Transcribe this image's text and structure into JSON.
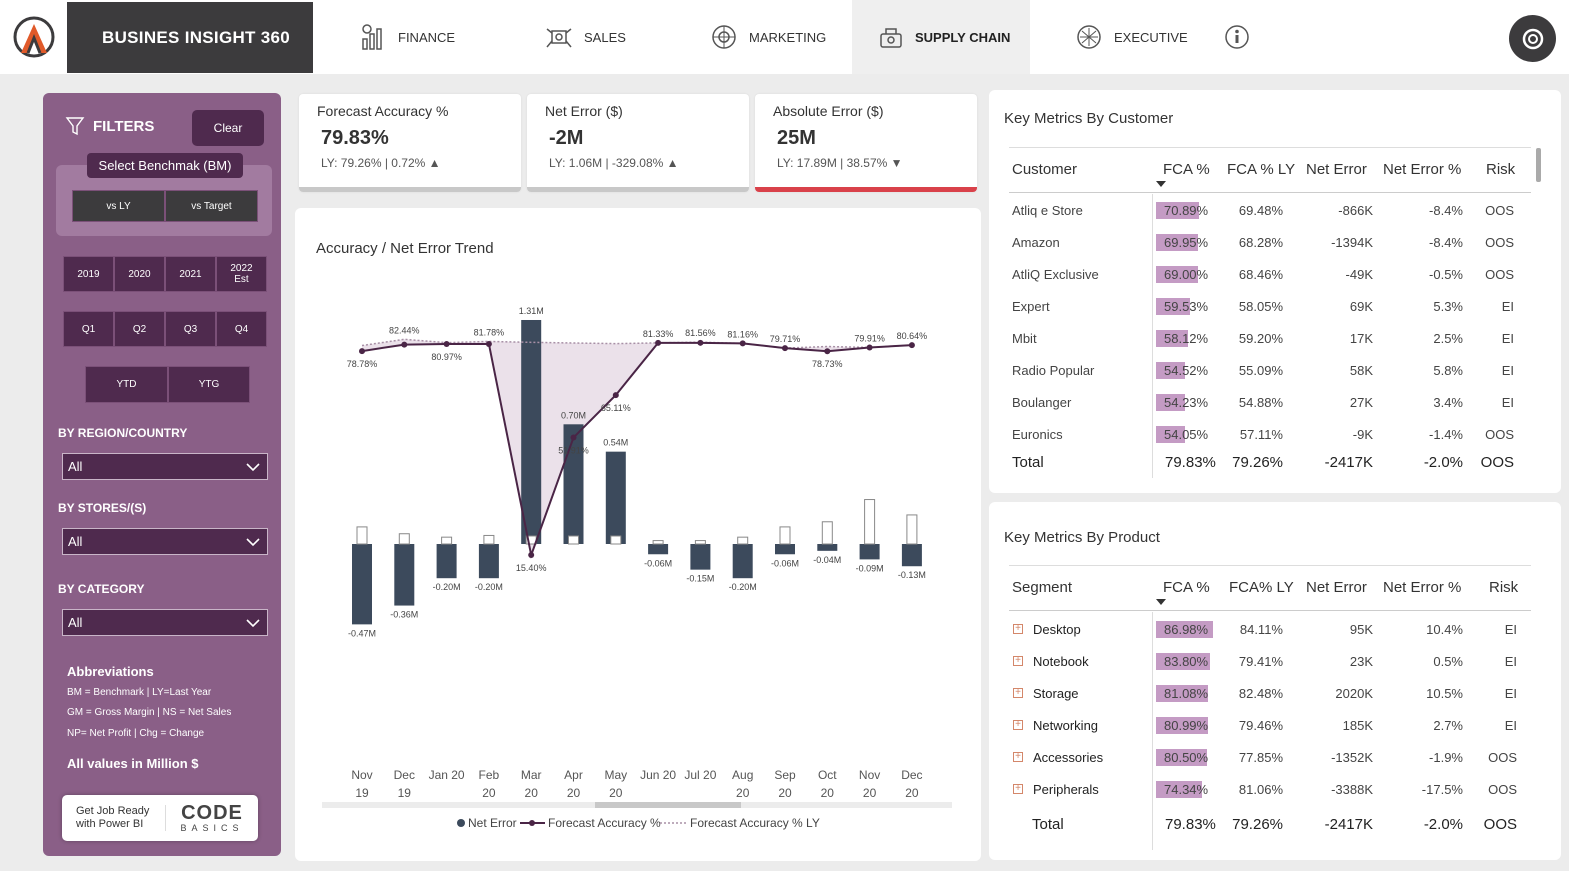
{
  "app": {
    "title": "BUSINES INSIGHT 360"
  },
  "nav": [
    {
      "label": "FINANCE",
      "icon": "finance-chart-icon"
    },
    {
      "label": "SALES",
      "icon": "sales-icon"
    },
    {
      "label": "MARKETING",
      "icon": "marketing-icon"
    },
    {
      "label": "SUPPLY CHAIN",
      "icon": "supply-chain-icon",
      "active": true
    },
    {
      "label": "EXECUTIVE",
      "icon": "executive-icon"
    }
  ],
  "filters": {
    "title": "FILTERS",
    "clear": "Clear",
    "benchmark_title": "Select Benchmak (BM)",
    "benchmark_options": [
      "vs LY",
      "vs Target"
    ],
    "years": [
      "2019",
      "2020",
      "2021",
      "2022 Est"
    ],
    "quarters": [
      "Q1",
      "Q2",
      "Q3",
      "Q4"
    ],
    "ytd": [
      "YTD",
      "YTG"
    ],
    "region_label": "BY REGION/COUNTRY",
    "region_value": "All",
    "stores_label": "BY STORES/(S)",
    "stores_value": "All",
    "category_label": "BY CATEGORY",
    "category_value": "All",
    "abbr_title": "Abbreviations",
    "abbr_lines": [
      "BM = Benchmark | LY=Last Year",
      "GM = Gross Margin | NS = Net Sales",
      "NP= Net Profit | Chg = Change"
    ],
    "values_note": "All values in Million $",
    "promo_text": "Get Job Ready with Power BI",
    "promo_logo_big": "CODE",
    "promo_logo_small": "BASICS"
  },
  "kpis": [
    {
      "title": "Forecast Accuracy %",
      "value": "79.83%",
      "sub": "LY: 79.26% | 0.72%",
      "trend": "up"
    },
    {
      "title": "Net Error ($)",
      "value": "-2M",
      "sub": "LY: 1.06M | -329.08%",
      "trend": "up"
    },
    {
      "title": "Absolute Error ($)",
      "value": "25M",
      "sub": "LY: 17.89M | 38.57%",
      "trend": "down"
    }
  ],
  "chart_data": {
    "type": "bar",
    "title": "Accuracy / Net Error Trend",
    "categories": [
      "Nov 19",
      "Dec 19",
      "Jan 20",
      "Feb 20",
      "Mar 20",
      "Apr 20",
      "May 20",
      "Jun 20",
      "Jul 20",
      "Aug 20",
      "Sep 20",
      "Oct 20",
      "Nov 20",
      "Dec 20"
    ],
    "tick_labels": [
      [
        "Nov",
        "19"
      ],
      [
        "Dec",
        "19"
      ],
      [
        "Jan 20",
        ""
      ],
      [
        "Feb",
        "20"
      ],
      [
        "Mar",
        "20"
      ],
      [
        "Apr",
        "20"
      ],
      [
        "May",
        "20"
      ],
      [
        "Jun 20",
        ""
      ],
      [
        "Jul 20",
        ""
      ],
      [
        "Aug",
        "20"
      ],
      [
        "Sep",
        "20"
      ],
      [
        "Oct",
        "20"
      ],
      [
        "Nov",
        "20"
      ],
      [
        "Dec",
        "20"
      ]
    ],
    "series": [
      {
        "name": "Net Error",
        "kind": "bar",
        "unit": "M",
        "values": [
          -0.47,
          -0.36,
          -0.2,
          -0.2,
          1.31,
          0.7,
          0.54,
          -0.06,
          -0.15,
          -0.2,
          -0.06,
          -0.04,
          -0.09,
          -0.13
        ],
        "labels": [
          "-0.47M",
          "-0.36M",
          "-0.20M",
          "-0.20M",
          "1.31M",
          "0.70M",
          "0.54M",
          "-0.06M",
          "-0.15M",
          "-0.20M",
          "-0.06M",
          "-0.04M",
          "-0.09M",
          "-0.13M"
        ]
      },
      {
        "name": "Forecast Accuracy %",
        "kind": "line",
        "unit": "%",
        "values": [
          78.78,
          80.8,
          80.97,
          81.0,
          15.4,
          51.91,
          65.11,
          81.33,
          81.35,
          81.16,
          79.71,
          78.73,
          79.91,
          80.64
        ],
        "labels": [
          "78.78%",
          "",
          "80.97%",
          "",
          "15.40%",
          "51.91%",
          "65.11%",
          "",
          "",
          "",
          "",
          "78.73%",
          "",
          ""
        ]
      },
      {
        "name": "Forecast Accuracy % LY",
        "kind": "dotted-line",
        "unit": "%",
        "values": [
          80.5,
          82.44,
          81.4,
          81.78,
          81.5,
          81.3,
          81.1,
          81.33,
          81.56,
          81.16,
          79.71,
          80.2,
          79.91,
          80.64
        ],
        "labels": [
          "",
          "82.44%",
          "",
          "81.78%",
          "",
          "",
          "",
          "81.33%",
          "81.56%",
          "81.16%",
          "79.71%",
          "",
          "79.91%",
          "80.64%"
        ]
      }
    ],
    "ly_net_error": [
      -0.1,
      -0.06,
      -0.04,
      -0.05,
      -0.04,
      -0.04,
      -0.02,
      -0.02,
      -0.02,
      -0.04,
      -0.1,
      -0.13,
      -0.26,
      -0.17
    ],
    "legend": [
      "Net Error",
      "Forecast Accuracy %",
      "Forecast Accuracy % LY"
    ],
    "legend_position": "bottom",
    "colors": {
      "bar": "#3c4a5c",
      "line": "#4a2546",
      "ly": "#a890a6",
      "fill": "#ebe1ea"
    }
  },
  "customer_table": {
    "title": "Key Metrics By Customer",
    "headers": [
      "Customer",
      "FCA %",
      "FCA % LY",
      "Net Error",
      "Net Error %",
      "Risk"
    ],
    "rows": [
      {
        "name": "Atliq e Store",
        "fca": "70.89%",
        "fca_num": 70.89,
        "fca_ly": "69.48%",
        "net_error": "-866K",
        "net_error_pct": "-8.4%",
        "risk": "OOS"
      },
      {
        "name": "Amazon",
        "fca": "69.95%",
        "fca_num": 69.95,
        "fca_ly": "68.28%",
        "net_error": "-1394K",
        "net_error_pct": "-8.4%",
        "risk": "OOS"
      },
      {
        "name": "AtliQ Exclusive",
        "fca": "69.00%",
        "fca_num": 69.0,
        "fca_ly": "68.46%",
        "net_error": "-49K",
        "net_error_pct": "-0.5%",
        "risk": "OOS"
      },
      {
        "name": "Expert",
        "fca": "59.53%",
        "fca_num": 59.53,
        "fca_ly": "58.05%",
        "net_error": "69K",
        "net_error_pct": "5.3%",
        "risk": "EI"
      },
      {
        "name": "Mbit",
        "fca": "58.12%",
        "fca_num": 58.12,
        "fca_ly": "59.20%",
        "net_error": "17K",
        "net_error_pct": "2.5%",
        "risk": "EI"
      },
      {
        "name": "Radio Popular",
        "fca": "54.52%",
        "fca_num": 54.52,
        "fca_ly": "55.09%",
        "net_error": "58K",
        "net_error_pct": "5.8%",
        "risk": "EI"
      },
      {
        "name": "Boulanger",
        "fca": "54.23%",
        "fca_num": 54.23,
        "fca_ly": "54.88%",
        "net_error": "27K",
        "net_error_pct": "3.4%",
        "risk": "EI"
      },
      {
        "name": "Euronics",
        "fca": "54.05%",
        "fca_num": 54.05,
        "fca_ly": "57.11%",
        "net_error": "-9K",
        "net_error_pct": "-1.4%",
        "risk": "OOS"
      }
    ],
    "total": {
      "name": "Total",
      "fca": "79.83%",
      "fca_ly": "79.26%",
      "net_error": "-2417K",
      "net_error_pct": "-2.0%",
      "risk": "OOS"
    }
  },
  "product_table": {
    "title": "Key Metrics By Product",
    "headers": [
      "Segment",
      "FCA %",
      "FCA% LY",
      "Net Error",
      "Net Error %",
      "Risk"
    ],
    "rows": [
      {
        "name": "Desktop",
        "fca": "86.98%",
        "fca_num": 86.98,
        "fca_ly": "84.11%",
        "net_error": "95K",
        "net_error_pct": "10.4%",
        "risk": "EI"
      },
      {
        "name": "Notebook",
        "fca": "83.80%",
        "fca_num": 83.8,
        "fca_ly": "79.41%",
        "net_error": "23K",
        "net_error_pct": "0.5%",
        "risk": "EI"
      },
      {
        "name": "Storage",
        "fca": "81.08%",
        "fca_num": 81.08,
        "fca_ly": "82.48%",
        "net_error": "2020K",
        "net_error_pct": "10.5%",
        "risk": "EI"
      },
      {
        "name": "Networking",
        "fca": "80.99%",
        "fca_num": 80.99,
        "fca_ly": "79.46%",
        "net_error": "185K",
        "net_error_pct": "2.7%",
        "risk": "EI"
      },
      {
        "name": "Accessories",
        "fca": "80.50%",
        "fca_num": 80.5,
        "fca_ly": "77.85%",
        "net_error": "-1352K",
        "net_error_pct": "-1.9%",
        "risk": "OOS"
      },
      {
        "name": "Peripherals",
        "fca": "74.34%",
        "fca_num": 74.34,
        "fca_ly": "81.06%",
        "net_error": "-3388K",
        "net_error_pct": "-17.5%",
        "risk": "OOS"
      }
    ],
    "total": {
      "name": "Total",
      "fca": "79.83%",
      "fca_ly": "79.26%",
      "net_error": "-2417K",
      "net_error_pct": "-2.0%",
      "risk": "OOS"
    }
  }
}
